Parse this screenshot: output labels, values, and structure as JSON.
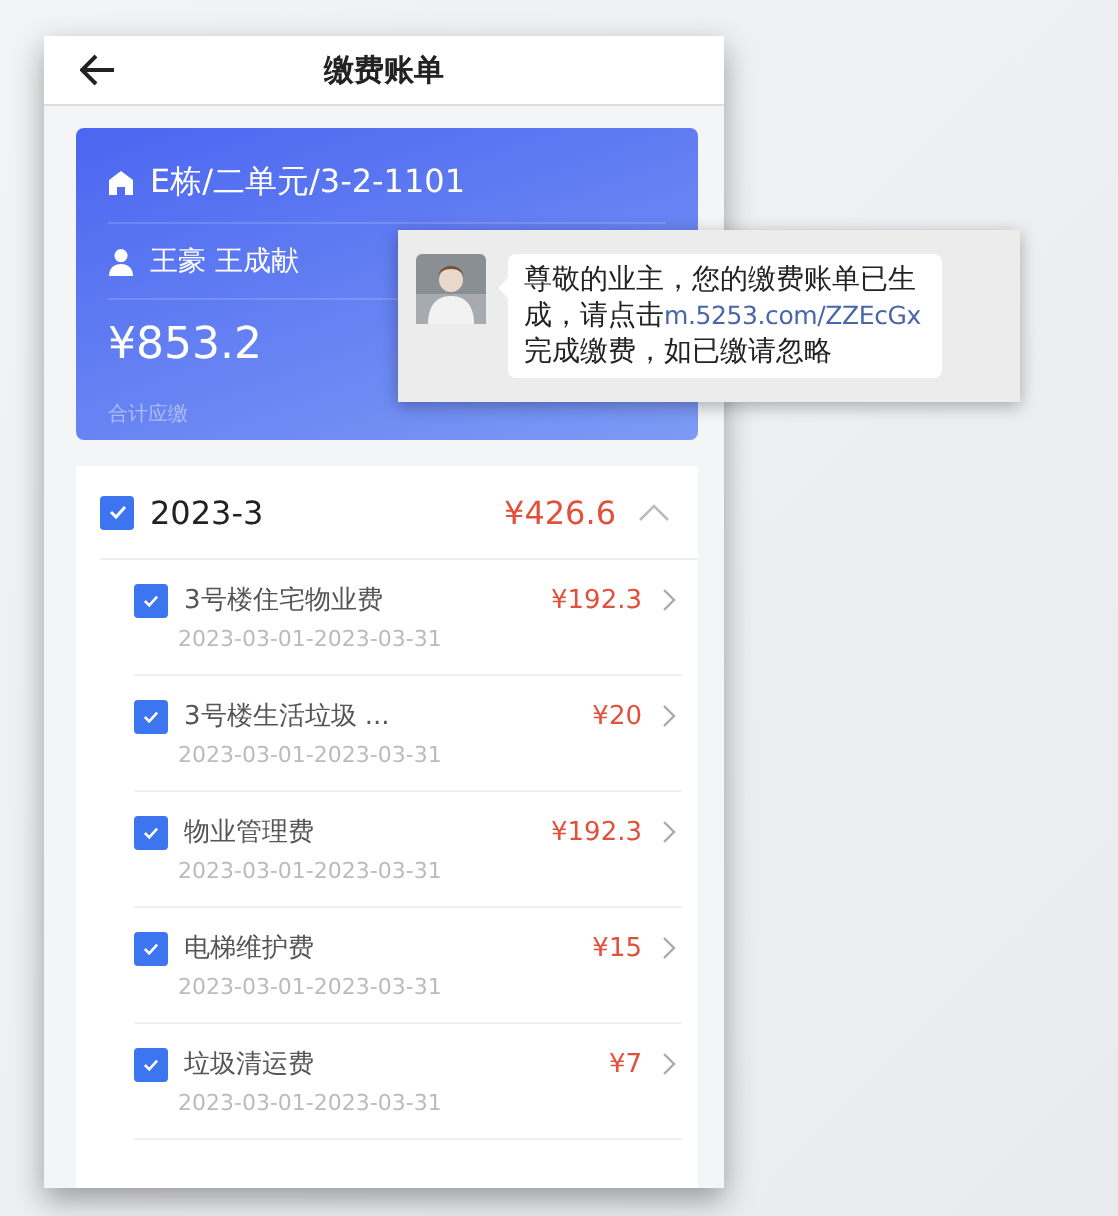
{
  "header": {
    "title": "缴费账单"
  },
  "summary": {
    "address": "E栋/二单元/3-2-1101",
    "owners": "王豪 王成献",
    "total": "¥853.2",
    "total_label": "合计应缴"
  },
  "bill_group": {
    "period": "2023-3",
    "checked": true,
    "amount": "¥426.6",
    "expanded": true,
    "items": [
      {
        "name": "3号楼住宅物业费",
        "amount": "¥192.3",
        "period": "2023-03-01-2023-03-31",
        "checked": true
      },
      {
        "name": "3号楼生活垃圾 ...",
        "amount": "¥20",
        "period": "2023-03-01-2023-03-31",
        "checked": true
      },
      {
        "name": "物业管理费",
        "amount": "¥192.3",
        "period": "2023-03-01-2023-03-31",
        "checked": true
      },
      {
        "name": "电梯维护费",
        "amount": "¥15",
        "period": "2023-03-01-2023-03-31",
        "checked": true
      },
      {
        "name": "垃圾清运费",
        "amount": "¥7",
        "period": "2023-03-01-2023-03-31",
        "checked": true
      }
    ]
  },
  "message": {
    "text_before": "尊敬的业主，您的缴费账单已生成，请点击",
    "link": "m.5253.com/ZZEcGx",
    "text_after": "完成缴费，如已缴请忽略"
  }
}
